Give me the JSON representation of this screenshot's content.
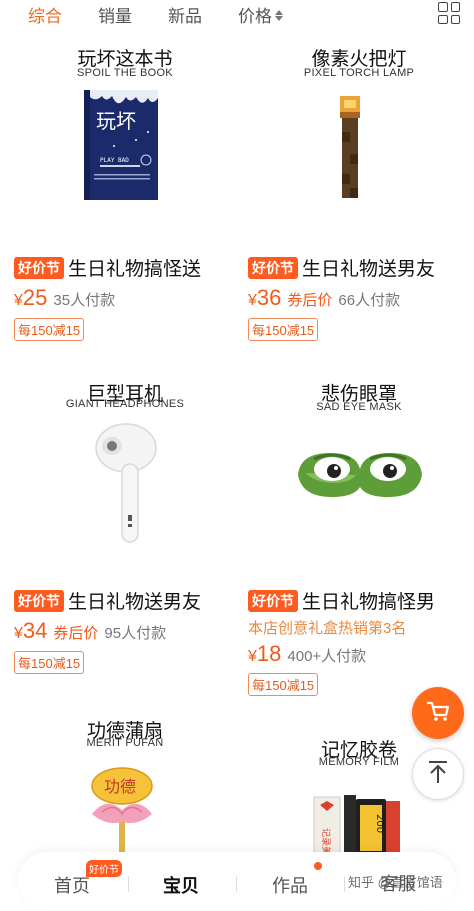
{
  "sort_bar": {
    "tabs": [
      "综合",
      "销量",
      "新品",
      "价格"
    ],
    "active_index": 0
  },
  "products": [
    {
      "title": "玩坏这本书",
      "subtitle": "SPOIL THE BOOK",
      "image_icon": "book-icon",
      "book_cover_text": "玩坏",
      "book_play_text": "PLAY BAD",
      "badge": "好价节",
      "name": "生日礼物搞怪送",
      "currency": "¥",
      "price": "25",
      "after_coupon": "",
      "sold": "35人付款",
      "rank": "",
      "promo": "每150减15"
    },
    {
      "title": "像素火把灯",
      "subtitle": "PIXEL TORCH LAMP",
      "image_icon": "torch-lamp-icon",
      "badge": "好价节",
      "name": "生日礼物送男友",
      "currency": "¥",
      "price": "36",
      "after_coupon": "券后价",
      "sold": "66人付款",
      "rank": "",
      "promo": "每150减15"
    },
    {
      "title": "巨型耳机",
      "subtitle": "GIANT HEADPHONES",
      "image_icon": "earbud-icon",
      "badge": "好价节",
      "name": "生日礼物送男友",
      "currency": "¥",
      "price": "34",
      "after_coupon": "券后价",
      "sold": "95人付款",
      "rank": "",
      "promo": "每150减15"
    },
    {
      "title": "悲伤眼罩",
      "subtitle": "SAD EYE MASK",
      "image_icon": "frog-eye-mask-icon",
      "badge": "好价节",
      "name": "生日礼物搞怪男",
      "currency": "¥",
      "price": "18",
      "after_coupon": "",
      "sold": "400+人付款",
      "rank": "本店创意礼盒热销第3名",
      "promo": "每150减15"
    },
    {
      "title": "功德蒲扇",
      "subtitle": "MERIT PUFAN",
      "image_icon": "lotus-fan-icon",
      "fan_text": "功德"
    },
    {
      "title": "记忆胶卷",
      "subtitle": "MEMORY FILM",
      "image_icon": "film-roll-icon",
      "film_text": "200",
      "film_box_text": "记录美好"
    }
  ],
  "bottom_nav": {
    "items": [
      "首页",
      "宝贝",
      "作品",
      "客服"
    ],
    "active_index": 1,
    "badge": "好价节"
  },
  "watermark": "知乎 @直言馆语",
  "colors": {
    "accent": "#f06a1e",
    "price": "#f05a1a",
    "badge_bg": "#ff5a1f",
    "rank_text": "#e8893e"
  }
}
